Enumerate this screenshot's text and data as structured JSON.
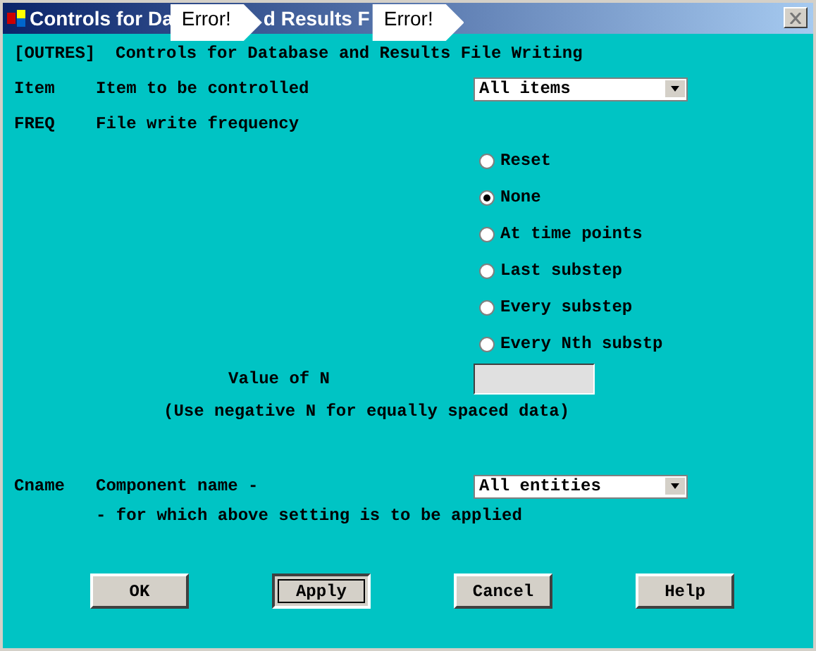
{
  "window": {
    "title_parts": [
      "Controls for Da",
      "d Results F"
    ],
    "callouts": [
      "Error!",
      "Error!"
    ]
  },
  "header": "[OUTRES]  Controls for Database and Results File Writing",
  "item": {
    "code": "Item",
    "label": "Item to be controlled",
    "value": "All items"
  },
  "freq": {
    "code": "FREQ",
    "label": "File write frequency"
  },
  "options": [
    {
      "label": "Reset",
      "selected": false
    },
    {
      "label": "None",
      "selected": true
    },
    {
      "label": "At time points",
      "selected": false
    },
    {
      "label": "Last substep",
      "selected": false
    },
    {
      "label": "Every substep",
      "selected": false
    },
    {
      "label": "Every Nth substp",
      "selected": false
    }
  ],
  "n_value": {
    "label": "Value of N",
    "hint": "(Use negative N for equally spaced data)"
  },
  "cname": {
    "code": "Cname",
    "label": "Component name -",
    "value": "All entities",
    "note": "- for which above setting is to be applied"
  },
  "buttons": [
    {
      "label": "OK",
      "focused": false
    },
    {
      "label": "Apply",
      "focused": true
    },
    {
      "label": "Cancel",
      "focused": false
    },
    {
      "label": "Help",
      "focused": false
    }
  ]
}
